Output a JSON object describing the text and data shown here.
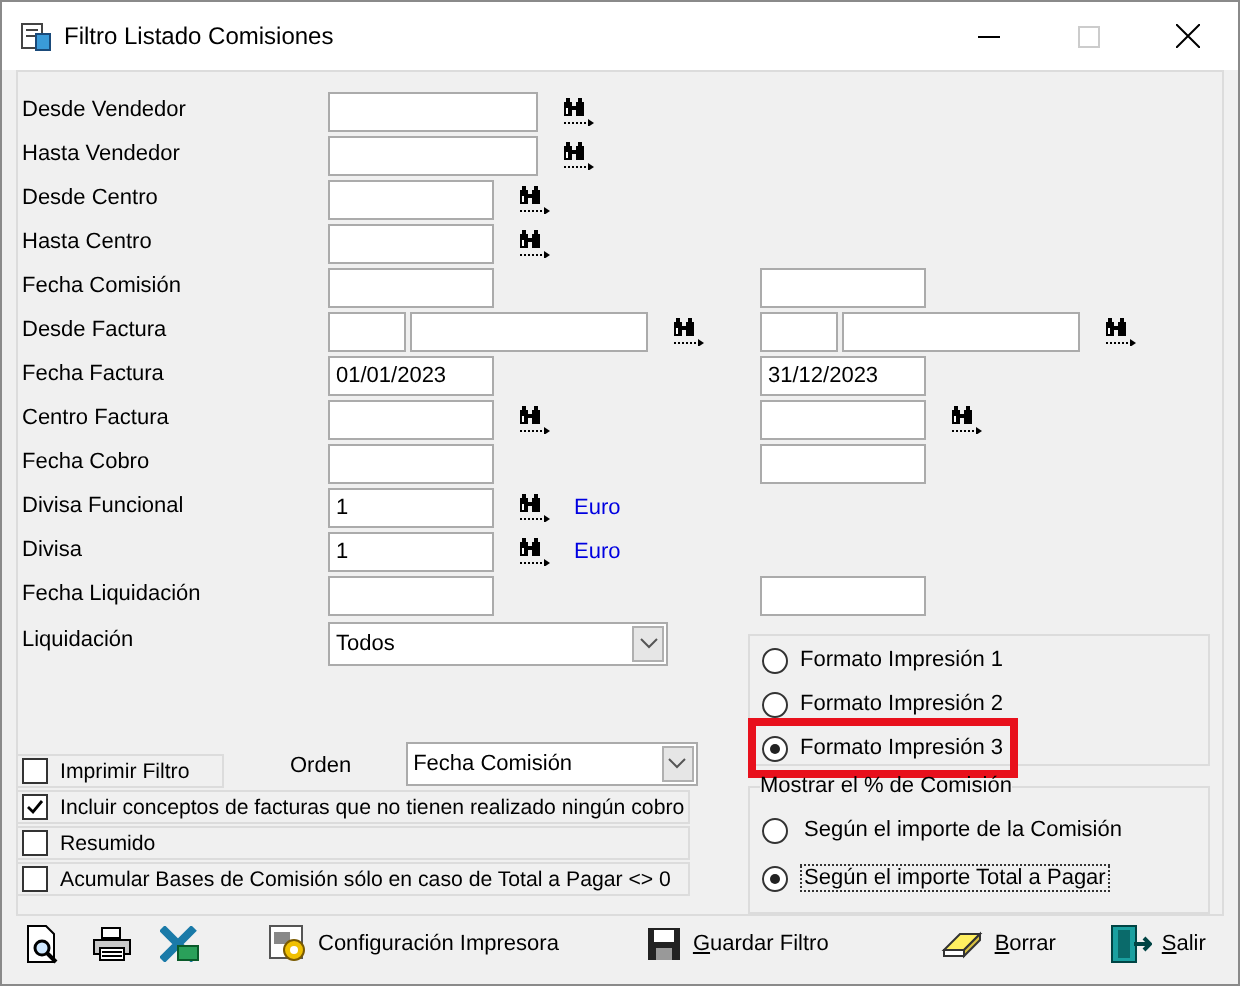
{
  "window": {
    "title": "Filtro Listado Comisiones"
  },
  "fields": [
    {
      "label": "Desde Vendedor",
      "left": {
        "inputs": [
          {
            "kind": "wide"
          }
        ],
        "lookup": true
      }
    },
    {
      "label": "Hasta Vendedor",
      "left": {
        "inputs": [
          {
            "kind": "wide"
          }
        ],
        "lookup": true
      }
    },
    {
      "label": "Desde Centro",
      "left": {
        "inputs": [
          {
            "kind": "medium"
          }
        ],
        "lookup": true
      }
    },
    {
      "label": "Hasta Centro",
      "left": {
        "inputs": [
          {
            "kind": "medium"
          }
        ],
        "lookup": true
      }
    },
    {
      "label": "Fecha Comisión",
      "left": {
        "inputs": [
          {
            "kind": "medium"
          }
        ]
      },
      "right": {
        "inputs": [
          {
            "kind": "medium"
          }
        ]
      }
    },
    {
      "label": "Desde Factura",
      "left": {
        "inputs": [
          {
            "kind": "short"
          },
          {
            "kind": "long"
          }
        ],
        "lookup": true
      },
      "right": {
        "inputs": [
          {
            "kind": "short"
          },
          {
            "kind": "long"
          }
        ],
        "lookup": true
      }
    },
    {
      "label": "Fecha Factura",
      "left": {
        "inputs": [
          {
            "kind": "medium",
            "value": "01/01/2023"
          }
        ]
      },
      "right": {
        "inputs": [
          {
            "kind": "medium",
            "value": "31/12/2023"
          }
        ]
      }
    },
    {
      "label": "Centro Factura",
      "left": {
        "inputs": [
          {
            "kind": "medium"
          }
        ],
        "lookup": true
      },
      "right": {
        "inputs": [
          {
            "kind": "medium"
          }
        ],
        "lookup": true
      }
    },
    {
      "label": "Fecha Cobro",
      "left": {
        "inputs": [
          {
            "kind": "medium"
          }
        ]
      },
      "right": {
        "inputs": [
          {
            "kind": "medium"
          }
        ]
      }
    },
    {
      "label": "Divisa Funcional",
      "left": {
        "inputs": [
          {
            "kind": "medium",
            "value": "1"
          }
        ],
        "lookup": true,
        "unit": "Euro"
      }
    },
    {
      "label": "Divisa",
      "left": {
        "inputs": [
          {
            "kind": "medium",
            "value": "1"
          }
        ],
        "lookup": true,
        "unit": "Euro"
      }
    },
    {
      "label": "Fecha Liquidación",
      "left": {
        "inputs": [
          {
            "kind": "medium"
          }
        ]
      },
      "right": {
        "inputs": [
          {
            "kind": "medium"
          }
        ]
      }
    }
  ],
  "liquidacion": {
    "label": "Liquidación",
    "value": "Todos"
  },
  "orden": {
    "label": "Orden",
    "value": "Fecha Comisión"
  },
  "options": [
    {
      "label": "Imprimir Filtro",
      "checked": false
    },
    {
      "label": "Incluir conceptos de facturas que no tienen realizado ningún cobro",
      "checked": true
    },
    {
      "label": "Resumido",
      "checked": false
    },
    {
      "label": "Acumular Bases de Comisión sólo en caso de Total a Pagar <> 0",
      "checked": false
    }
  ],
  "print_formats": [
    {
      "label": "Formato Impresión 1",
      "selected": false,
      "highlighted": false
    },
    {
      "label": "Formato Impresión 2",
      "selected": false,
      "highlighted": false
    },
    {
      "label": "Formato Impresión 3",
      "selected": true,
      "highlighted": true
    }
  ],
  "commission_display": {
    "title": "Mostrar el % de Comisión",
    "options": [
      {
        "label": "Según el importe de la Comisión",
        "selected": false,
        "focused": false
      },
      {
        "label": "Según el importe Total a Pagar",
        "selected": true,
        "focused": true
      }
    ]
  },
  "toolbar": [
    {
      "kind": "preview"
    },
    {
      "kind": "print"
    },
    {
      "kind": "export"
    },
    {
      "kind": "setup",
      "label": "Configuración Impresora",
      "mnemonic": false
    },
    {
      "kind": "save",
      "label": "Guardar Filtro",
      "mnemonic": true
    },
    {
      "kind": "erase",
      "label": "Borrar",
      "mnemonic": true
    },
    {
      "kind": "exit",
      "label": "Salir",
      "mnemonic": true
    }
  ]
}
